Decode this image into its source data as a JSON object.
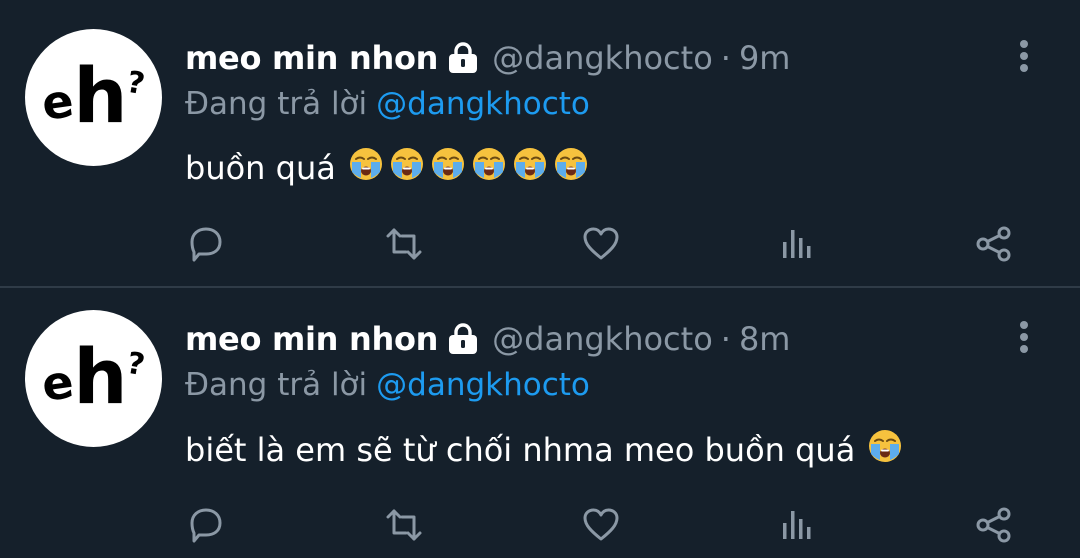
{
  "colors": {
    "background": "#15202b",
    "text": "#ffffff",
    "muted": "#8b98a5",
    "link": "#1d9bf0",
    "divider": "#2f3b47"
  },
  "tweets": [
    {
      "display_name": "meo min nhon",
      "handle": "@dangkhocto",
      "separator": "·",
      "time": "9m",
      "reply_prefix": "Đang trả lời",
      "reply_handle": "@dangkhocto",
      "text": "buồn quá",
      "emoji_count": 6,
      "emoji": "loudly-crying-face",
      "avatar_text": {
        "e": "e",
        "h": "h",
        "q": "?"
      }
    },
    {
      "display_name": "meo min nhon",
      "handle": "@dangkhocto",
      "separator": "·",
      "time": "8m",
      "reply_prefix": "Đang trả lời",
      "reply_handle": "@dangkhocto",
      "text": "biết là em sẽ từ chối nhma meo buồn quá",
      "emoji_count": 1,
      "emoji": "loudly-crying-face",
      "avatar_text": {
        "e": "e",
        "h": "h",
        "q": "?"
      }
    }
  ],
  "icons": {
    "lock": "lock-icon",
    "more": "more-vertical-icon",
    "reply": "reply-icon",
    "retweet": "retweet-icon",
    "like": "heart-icon",
    "stats": "stats-icon",
    "share": "share-icon"
  }
}
